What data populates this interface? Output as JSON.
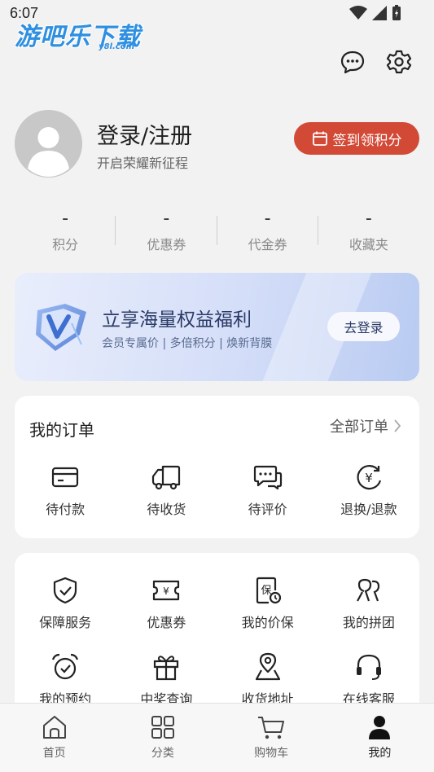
{
  "status_bar": {
    "time": "6:07"
  },
  "watermark": {
    "main": "游吧乐下载",
    "sub": "y8l.com"
  },
  "header_icons": [
    "message-icon",
    "settings-icon"
  ],
  "profile": {
    "title": "登录/注册",
    "subtitle": "开启荣耀新征程",
    "signin_label": "签到领积分",
    "signin_color": "#d24936"
  },
  "stats": [
    {
      "value": "-",
      "label": "积分"
    },
    {
      "value": "-",
      "label": "优惠券"
    },
    {
      "value": "-",
      "label": "代金券"
    },
    {
      "value": "-",
      "label": "收藏夹"
    }
  ],
  "banner": {
    "title": "立享海量权益福利",
    "subtitle": "会员专属价 | 多倍积分 | 焕新背膜",
    "button": "去登录"
  },
  "orders": {
    "title": "我的订单",
    "all_label": "全部订单",
    "items": [
      {
        "label": "待付款",
        "icon": "card-icon"
      },
      {
        "label": "待收货",
        "icon": "truck-icon"
      },
      {
        "label": "待评价",
        "icon": "comment-icon"
      },
      {
        "label": "退换/退款",
        "icon": "refund-icon"
      }
    ]
  },
  "services": {
    "row1": [
      {
        "label": "保障服务",
        "icon": "shield-icon"
      },
      {
        "label": "优惠券",
        "icon": "coupon-icon"
      },
      {
        "label": "我的价保",
        "icon": "price-protect-icon"
      },
      {
        "label": "我的拼团",
        "icon": "group-icon"
      }
    ],
    "row2": [
      {
        "label": "我的预约",
        "icon": "alarm-icon"
      },
      {
        "label": "中奖查询",
        "icon": "gift-icon"
      },
      {
        "label": "收货地址",
        "icon": "location-icon"
      },
      {
        "label": "在线客服",
        "icon": "headset-icon"
      }
    ]
  },
  "tabbar": [
    {
      "label": "首页",
      "icon": "home-icon"
    },
    {
      "label": "分类",
      "icon": "grid-icon"
    },
    {
      "label": "购物车",
      "icon": "cart-icon"
    },
    {
      "label": "我的",
      "icon": "person-icon",
      "active": true
    }
  ]
}
